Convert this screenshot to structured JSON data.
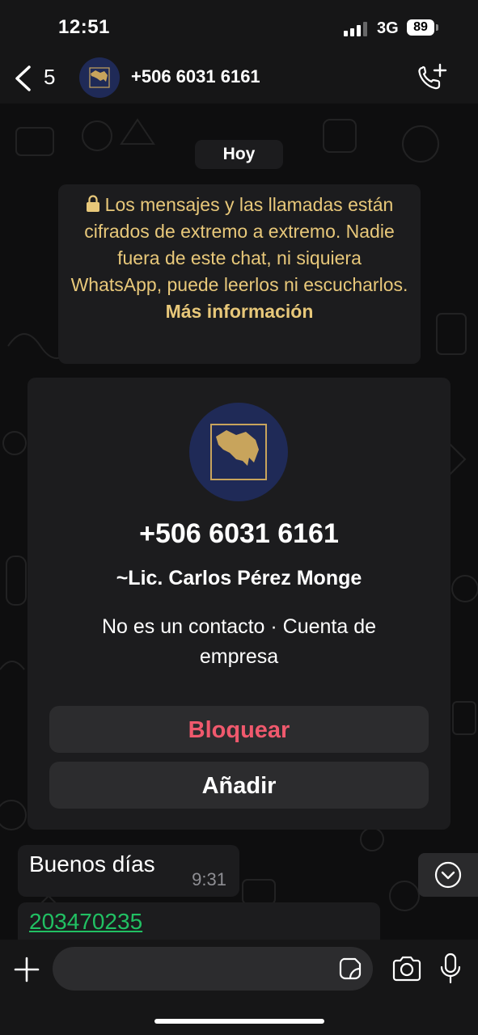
{
  "status": {
    "time": "12:51",
    "network": "3G",
    "battery": "89"
  },
  "header": {
    "back_count": "5",
    "title": "+506 6031 6161"
  },
  "chat": {
    "day": "Hoy",
    "encryption": {
      "text": "Los mensajes y las llamadas están cifrados de extremo a extremo. Nadie fuera de este chat, ni siquiera WhatsApp, puede leerlos ni escucharlos.",
      "link": "Más información"
    },
    "card": {
      "phone": "+506 6031 6161",
      "name": "~Lic. Carlos Pérez Monge",
      "meta": "No es un contacto · Cuenta de empresa",
      "block_label": "Bloquear",
      "add_label": "Añadir"
    },
    "messages": [
      {
        "text": "Buenos días",
        "time": "9:31"
      },
      {
        "text": "203470235"
      }
    ]
  },
  "colors": {
    "accent_green": "#21c063",
    "encryption_text": "#e8c87a",
    "block_red": "#f0596d",
    "avatar_navy": "#1f2a57",
    "logo_gold": "#c8a45c"
  },
  "icons": [
    "back-chevron-icon",
    "add-call-icon",
    "lock-icon",
    "chevron-down-icon",
    "plus-icon",
    "sticker-icon",
    "camera-icon",
    "microphone-icon"
  ]
}
